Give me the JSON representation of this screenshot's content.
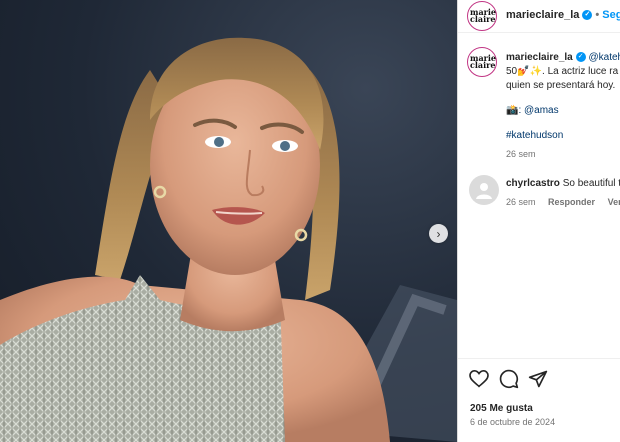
{
  "post": {
    "image_alt": "Kate Hudson en alfombra roja",
    "account": "marieclaire_la",
    "avatar_text": "marie claire",
    "follow_label": "Seguir",
    "caption_user": "marieclaire_la",
    "caption_line1": "@katehu",
    "caption_line2": "50💅✨. La actriz luce ra",
    "caption_line3": "quien se presentará hoy.",
    "credit": "📸: @amas",
    "hashtag": "#katehudson",
    "caption_time": "26 sem"
  },
  "comment": {
    "user": "chyrlcastro",
    "text": "So beautiful t",
    "time": "26 sem",
    "reply_label": "Responder",
    "view_label": "Ver tra"
  },
  "footer": {
    "likes": "205 Me gusta",
    "date": "6 de octubre de 2024"
  },
  "colors": {
    "accent": "#0095f6",
    "ring": "#c13584"
  }
}
